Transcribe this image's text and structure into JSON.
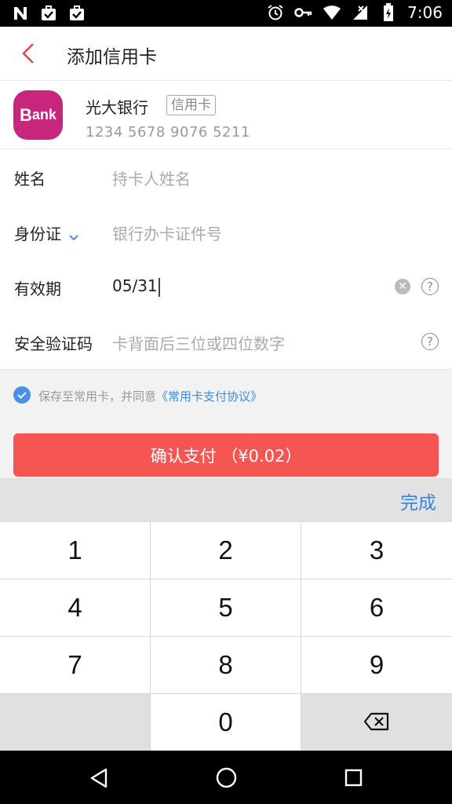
{
  "status_bar": {
    "time": "7:06",
    "left_icons": [
      "n-icon",
      "briefcase-check-icon",
      "briefcase-check-icon"
    ],
    "right_icons": [
      "alarm-icon",
      "key-icon",
      "wifi-icon",
      "signal-off-icon",
      "battery-charging-icon"
    ]
  },
  "header": {
    "title": "添加信用卡"
  },
  "bank": {
    "logo_text_b": "B",
    "logo_text_rest": "ank",
    "name": "光大银行",
    "card_type": "信用卡",
    "card_number": "1234 5678 9076 5211"
  },
  "form": {
    "name": {
      "label": "姓名",
      "placeholder": "持卡人姓名"
    },
    "id_type": {
      "label": "身份证",
      "placeholder": "银行办卡证件号"
    },
    "expiry": {
      "label": "有效期",
      "value": "05/31"
    },
    "cvv": {
      "label": "安全验证码",
      "placeholder": "卡背面后三位或四位数字"
    }
  },
  "agreement": {
    "text": "保存至常用卡，并同意",
    "link": "《常用卡支付协议》",
    "checked": true
  },
  "pay_button": {
    "label": "确认支付  （¥0.02）"
  },
  "keyboard": {
    "done": "完成",
    "keys": [
      "1",
      "2",
      "3",
      "4",
      "5",
      "6",
      "7",
      "8",
      "9",
      "",
      "0",
      "backspace"
    ]
  },
  "colors": {
    "accent_red": "#f55653",
    "link_blue": "#3d8ae0",
    "bank_pink": "#c8267c"
  }
}
